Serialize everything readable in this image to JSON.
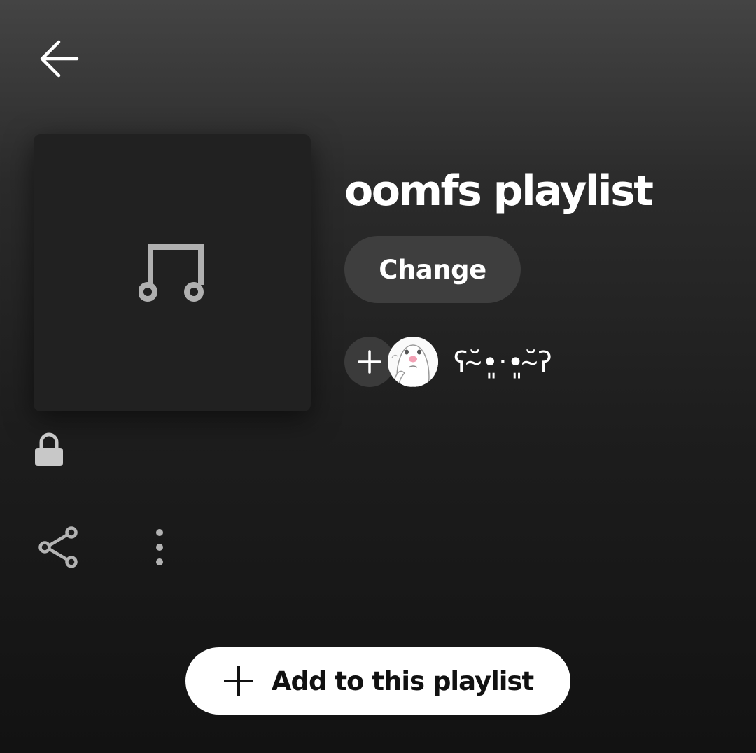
{
  "header": {
    "back_icon": "arrow-left-icon"
  },
  "playlist": {
    "title": "oomfs playlist",
    "cover_icon": "music-note-icon",
    "change_label": "Change",
    "owner_name": "ʕ˘̴•͈‧•͈˘̴ʔ",
    "privacy_icon": "lock-icon"
  },
  "actions": {
    "add_collaborator_icon": "plus-icon",
    "share_icon": "share-icon",
    "more_icon": "more-vertical-icon",
    "add_to_playlist_label": "Add to this playlist",
    "add_to_playlist_icon": "plus-icon"
  },
  "colors": {
    "background_top": "#444444",
    "background_bottom": "#121212",
    "cover_background": "#212121",
    "pill_button": "#3e3e3e",
    "primary_button": "#ffffff",
    "icon_gray": "#b3b3b3"
  }
}
